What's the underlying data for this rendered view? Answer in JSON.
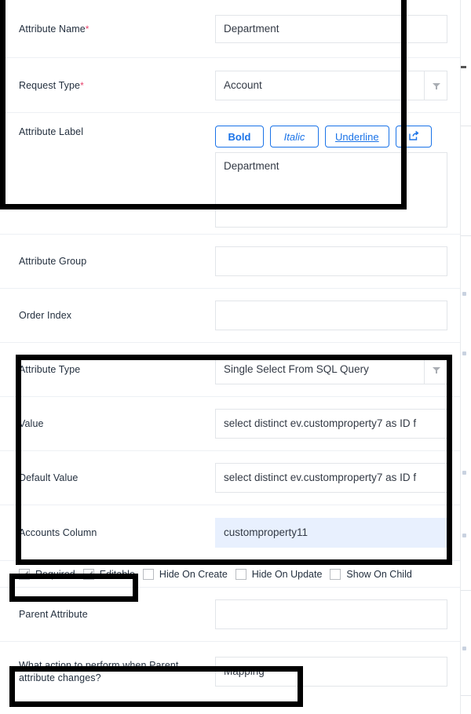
{
  "form": {
    "rows": [
      {
        "label": "Attribute Name",
        "required": true,
        "value": "Department",
        "control": "text"
      },
      {
        "label": "Request Type",
        "required": true,
        "value": "Account",
        "control": "select"
      },
      {
        "label": "Attribute Label",
        "required": false,
        "value": "Department",
        "control": "richtext"
      },
      {
        "label": "Attribute Group",
        "required": false,
        "value": "",
        "control": "text"
      },
      {
        "label": "Order Index",
        "required": false,
        "value": "",
        "control": "text"
      },
      {
        "label": "Attribute Type",
        "required": false,
        "value": "Single Select From SQL Query",
        "control": "select"
      },
      {
        "label": "Value",
        "required": false,
        "value": "select distinct ev.customproperty7 as ID f",
        "control": "text"
      },
      {
        "label": "Default Value",
        "required": false,
        "value": "select distinct ev.customproperty7 as ID f",
        "control": "text"
      },
      {
        "label": "Accounts Column",
        "required": false,
        "value": "customproperty11",
        "control": "text-highlight"
      },
      {
        "label": "Parent Attribute",
        "required": false,
        "value": "",
        "control": "text"
      },
      {
        "label": "What action to perform when Parent attribute changes?",
        "required": false,
        "value": "Mapping",
        "control": "text"
      }
    ]
  },
  "richtext": {
    "buttons": [
      {
        "label": "Bold",
        "style": "bold"
      },
      {
        "label": "Italic",
        "style": "italic"
      },
      {
        "label": "Underline",
        "style": "underline"
      },
      {
        "label": "",
        "style": "icon",
        "icon": "external-link-icon"
      }
    ],
    "content": "Department"
  },
  "checkboxes": [
    {
      "label": "Required",
      "checked": true
    },
    {
      "label": "Editable",
      "checked": true
    },
    {
      "label": "Hide On Create",
      "checked": false
    },
    {
      "label": "Hide On Update",
      "checked": false
    },
    {
      "label": "Show On Child",
      "checked": false
    }
  ],
  "colors": {
    "accent": "#1a73e8",
    "required_marker": "#e8436d",
    "highlight_bg": "#e8f0fe",
    "border": "#e2e5e9",
    "divider": "#edf0f4",
    "text": "#24303f",
    "annotation": "#000000"
  },
  "annotations": [
    {
      "name": "annotation-box-top",
      "covers": "Attribute Name, Request Type, Attribute Label"
    },
    {
      "name": "annotation-box-middle",
      "covers": "Attribute Type, Value, Default Value, Accounts Column"
    },
    {
      "name": "annotation-box-checkboxes",
      "covers": "Required, Editable"
    },
    {
      "name": "annotation-box-bottom",
      "covers": "What action to perform when Parent attribute changes?"
    }
  ]
}
